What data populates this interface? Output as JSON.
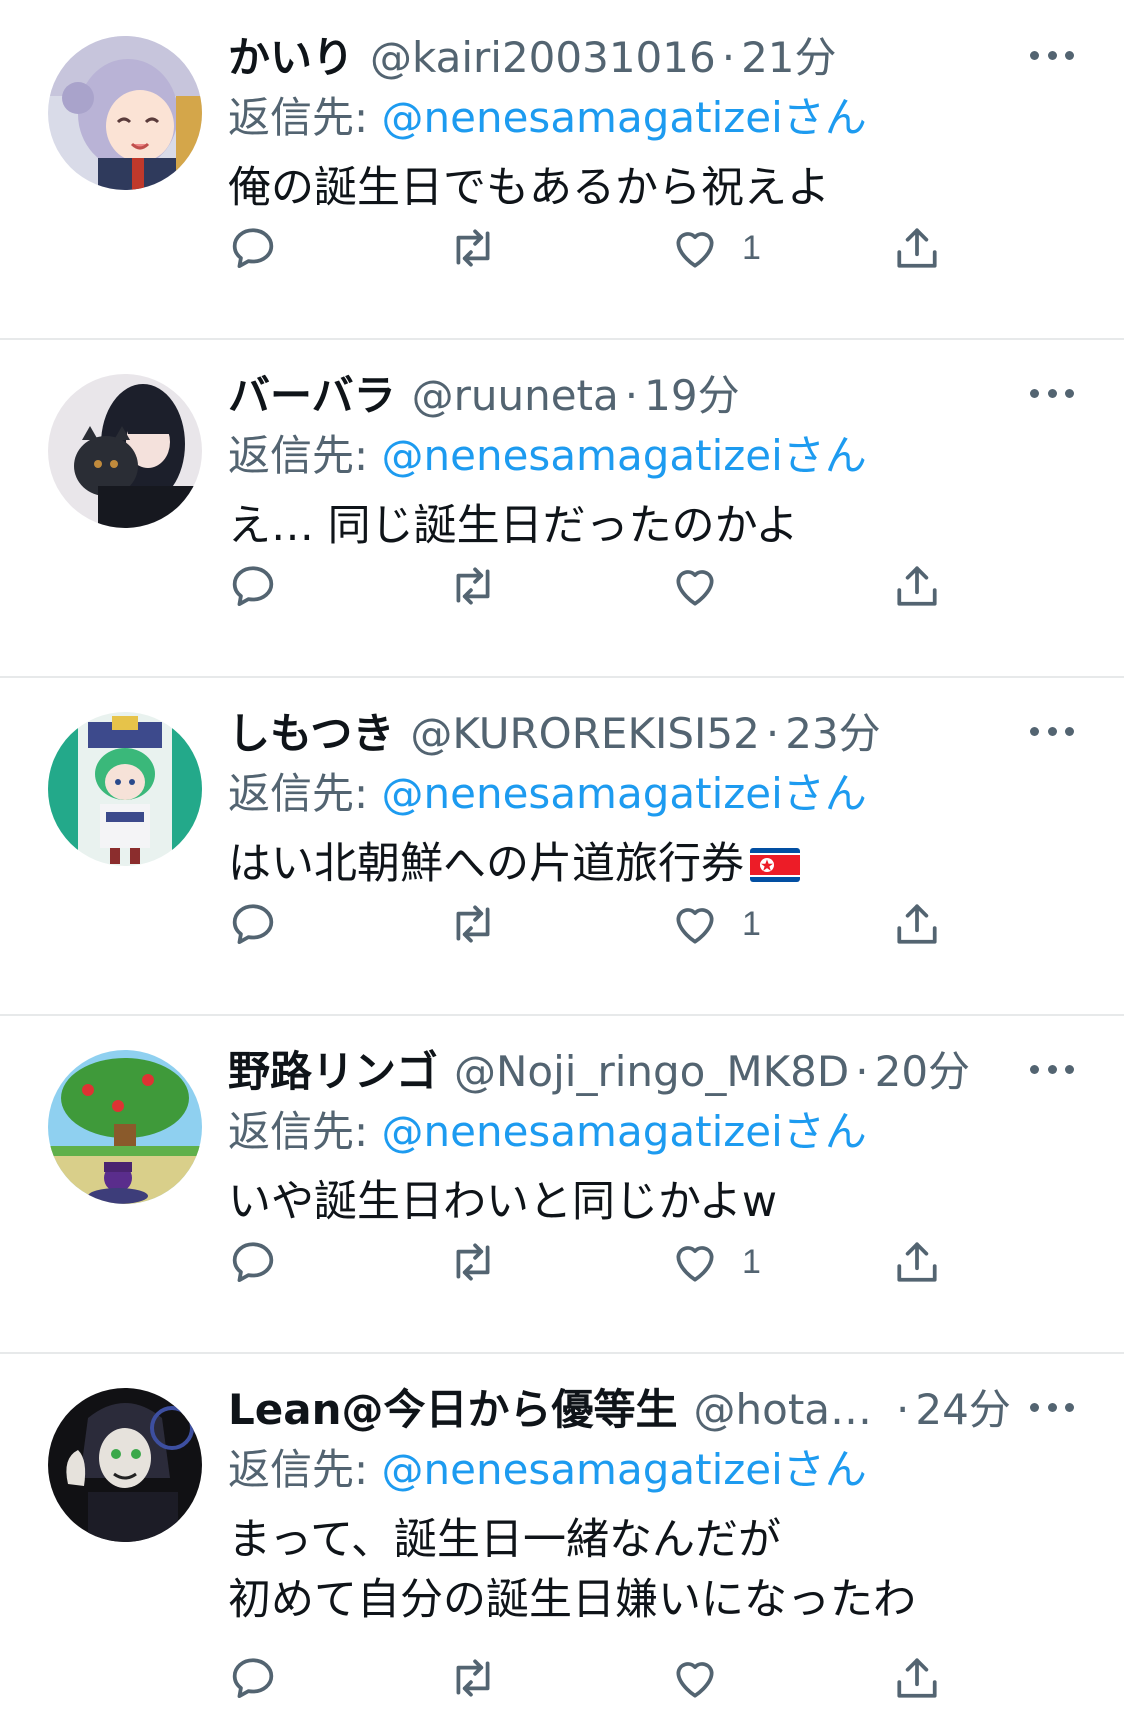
{
  "reply_prefix": "返信先: ",
  "reply_suffix": "さん",
  "separator": "·",
  "tweets": [
    {
      "name": "かいり",
      "handle": "@kairi20031016",
      "time": "21分",
      "reply_to": "@nenesamagatizei",
      "text": "俺の誕生日でもあるから祝えよ",
      "likes": "1"
    },
    {
      "name": "バーバラ",
      "handle": "@ruuneta",
      "time": "19分",
      "reply_to": "@nenesamagatizei",
      "text": "え… 同じ誕生日だったのかよ",
      "likes": ""
    },
    {
      "name": "しもつき",
      "handle": "@KUROREKISI52",
      "time": "23分",
      "reply_to": "@nenesamagatizei",
      "text": "はい北朝鮮への片道旅行券",
      "emoji": "flag-north-korea",
      "likes": "1"
    },
    {
      "name": "野路リンゴ",
      "handle": "@Noji_ringo_MK8D",
      "time": "20分",
      "reply_to": "@nenesamagatizei",
      "text": "いや誕生日わいと同じかよw",
      "likes": "1"
    },
    {
      "name": "Lean@今日から優等生",
      "handle": "@hota…",
      "time": "24分",
      "reply_to": "@nenesamagatizei",
      "text": "まって、誕生日一緒なんだが\n初めて自分の誕生日嫌いになったわ",
      "likes": ""
    }
  ],
  "icons": {
    "reply": "speech-bubble-icon",
    "retweet": "retweet-arrows-icon",
    "like": "heart-icon",
    "share": "share-upload-icon",
    "more": "more-dots-icon"
  },
  "colors": {
    "text": "#0f1419",
    "secondary": "#536471",
    "link": "#1d9bf0",
    "divider": "#e7e9ea"
  }
}
